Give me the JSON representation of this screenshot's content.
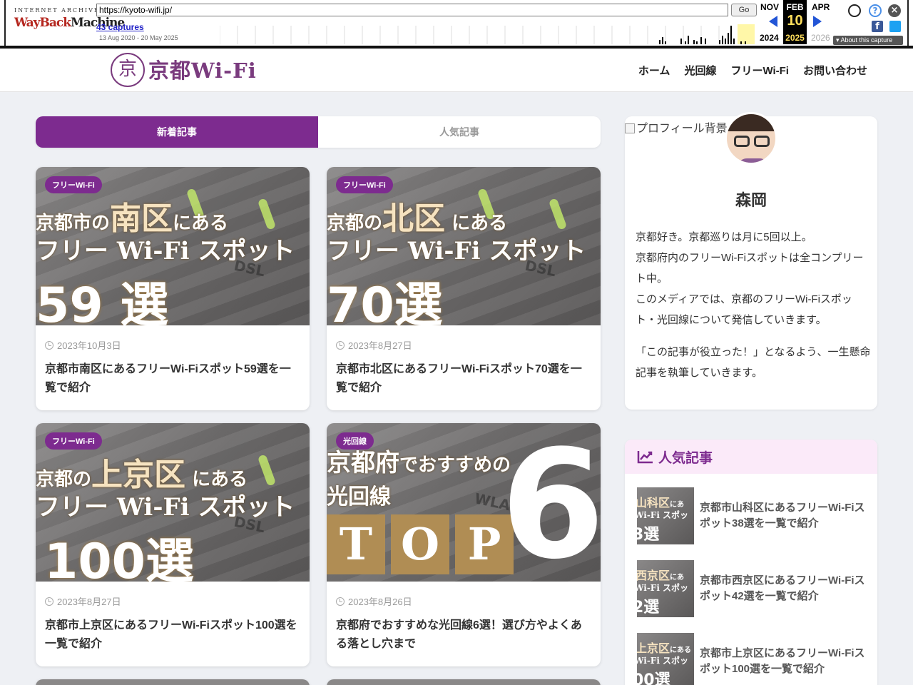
{
  "wayback": {
    "logo_top": "INTERNET ARCHIVE",
    "logo_a": "WayBack",
    "logo_b": "Machine",
    "url": "https://kyoto-wifi.jp/",
    "go": "Go",
    "captures": "43 captures",
    "range": "13 Aug 2020 - 20 May 2025",
    "prev_month": "NOV",
    "cur_month": "FEB",
    "next_month": "APR",
    "cur_day": "10",
    "prev_year": "2024",
    "cur_year": "2025",
    "next_year": "2026",
    "about": "About this capture",
    "colors": {
      "accent_red": "#b5271f",
      "link_blue": "#2525c8",
      "current_bg": "#000000",
      "current_fg": "#ffde5c"
    }
  },
  "header": {
    "logo_mark": "京",
    "logo_text": "京都Wi-Fi",
    "nav": [
      "ホーム",
      "光回線",
      "フリーWi-Fi",
      "お問い合わせ"
    ]
  },
  "tabs": {
    "new": "新着記事",
    "popular": "人気記事"
  },
  "cards": [
    {
      "category": "フリーWi-Fi",
      "thumb_l1a": "京都市の",
      "thumb_l1b": "南区",
      "thumb_l1c": "にある",
      "thumb_l2": "フリー Wi-Fi スポット",
      "thumb_l3": "59 選",
      "thumb_dsl": "DSL",
      "date": "2023年10月3日",
      "title": "京都市南区にあるフリーWi-Fiスポット59選を一覧で紹介"
    },
    {
      "category": "フリーWi-Fi",
      "thumb_l1a": "京都の",
      "thumb_l1b": "北区",
      "thumb_l1c": "にある",
      "thumb_l2": "フリー Wi-Fi スポット",
      "thumb_l3": "70選",
      "thumb_dsl": "DSL",
      "date": "2023年8月27日",
      "title": "京都市北区にあるフリーWi-Fiスポット70選を一覧で紹介"
    },
    {
      "category": "フリーWi-Fi",
      "thumb_l1a": "京都の",
      "thumb_l1b": "上京区",
      "thumb_l1c": "にある",
      "thumb_l2": "フリー Wi-Fi スポット",
      "thumb_l3": "100選",
      "thumb_dsl": "DSL",
      "date": "2023年8月27日",
      "title": "京都市上京区にあるフリーWi-Fiスポット100選を一覧で紹介"
    },
    {
      "category": "光回線",
      "thumb_l1a": "京都府",
      "thumb_l1b": "でおすすめの",
      "thumb_l2": "光回線",
      "thumb_t": "T",
      "thumb_o": "O",
      "thumb_p": "P",
      "thumb_six": "6",
      "thumb_wlan": "WLAN",
      "date": "2023年8月26日",
      "title": "京都府でおすすめな光回線6選！選び方やよくある落とし穴まで"
    }
  ],
  "profile": {
    "bg_alt": "プロフィール背景",
    "name": "森岡",
    "bio1": "京都好き。京都巡りは月に5回以上。",
    "bio2": "京都府内のフリーWi-Fiスポットは全コンプリート中。",
    "bio3": "このメディアでは、京都のフリーWi-Fiスポット・光回線について発信していきます。",
    "bio4": "「この記事が役立った！」となるよう、一生懸命記事を執筆していきます。"
  },
  "popular": {
    "heading": "人気記事",
    "items": [
      {
        "t1": "山科区",
        "t1s": "にあ",
        "t2": "Wi-Fi スポッ",
        "t3": "3選",
        "title": "京都市山科区にあるフリーWi-Fiスポット38選を一覧で紹介"
      },
      {
        "t1": "西京区",
        "t1s": "にあ",
        "t2": "Wi-Fi スポッ",
        "t3": "2選",
        "title": "京都市西京区にあるフリーWi-Fiスポット42選を一覧で紹介"
      },
      {
        "t1": "上京区",
        "t1s": "にある",
        "t2": "Wi-Fi スポッ",
        "t3": "00選",
        "title": "京都市上京区にあるフリーWi-Fiスポット100選を一覧で紹介"
      }
    ]
  },
  "theme": {
    "primary": "#7d2b8f",
    "logo": "#7a3b7e",
    "background": "#eef0f4"
  }
}
